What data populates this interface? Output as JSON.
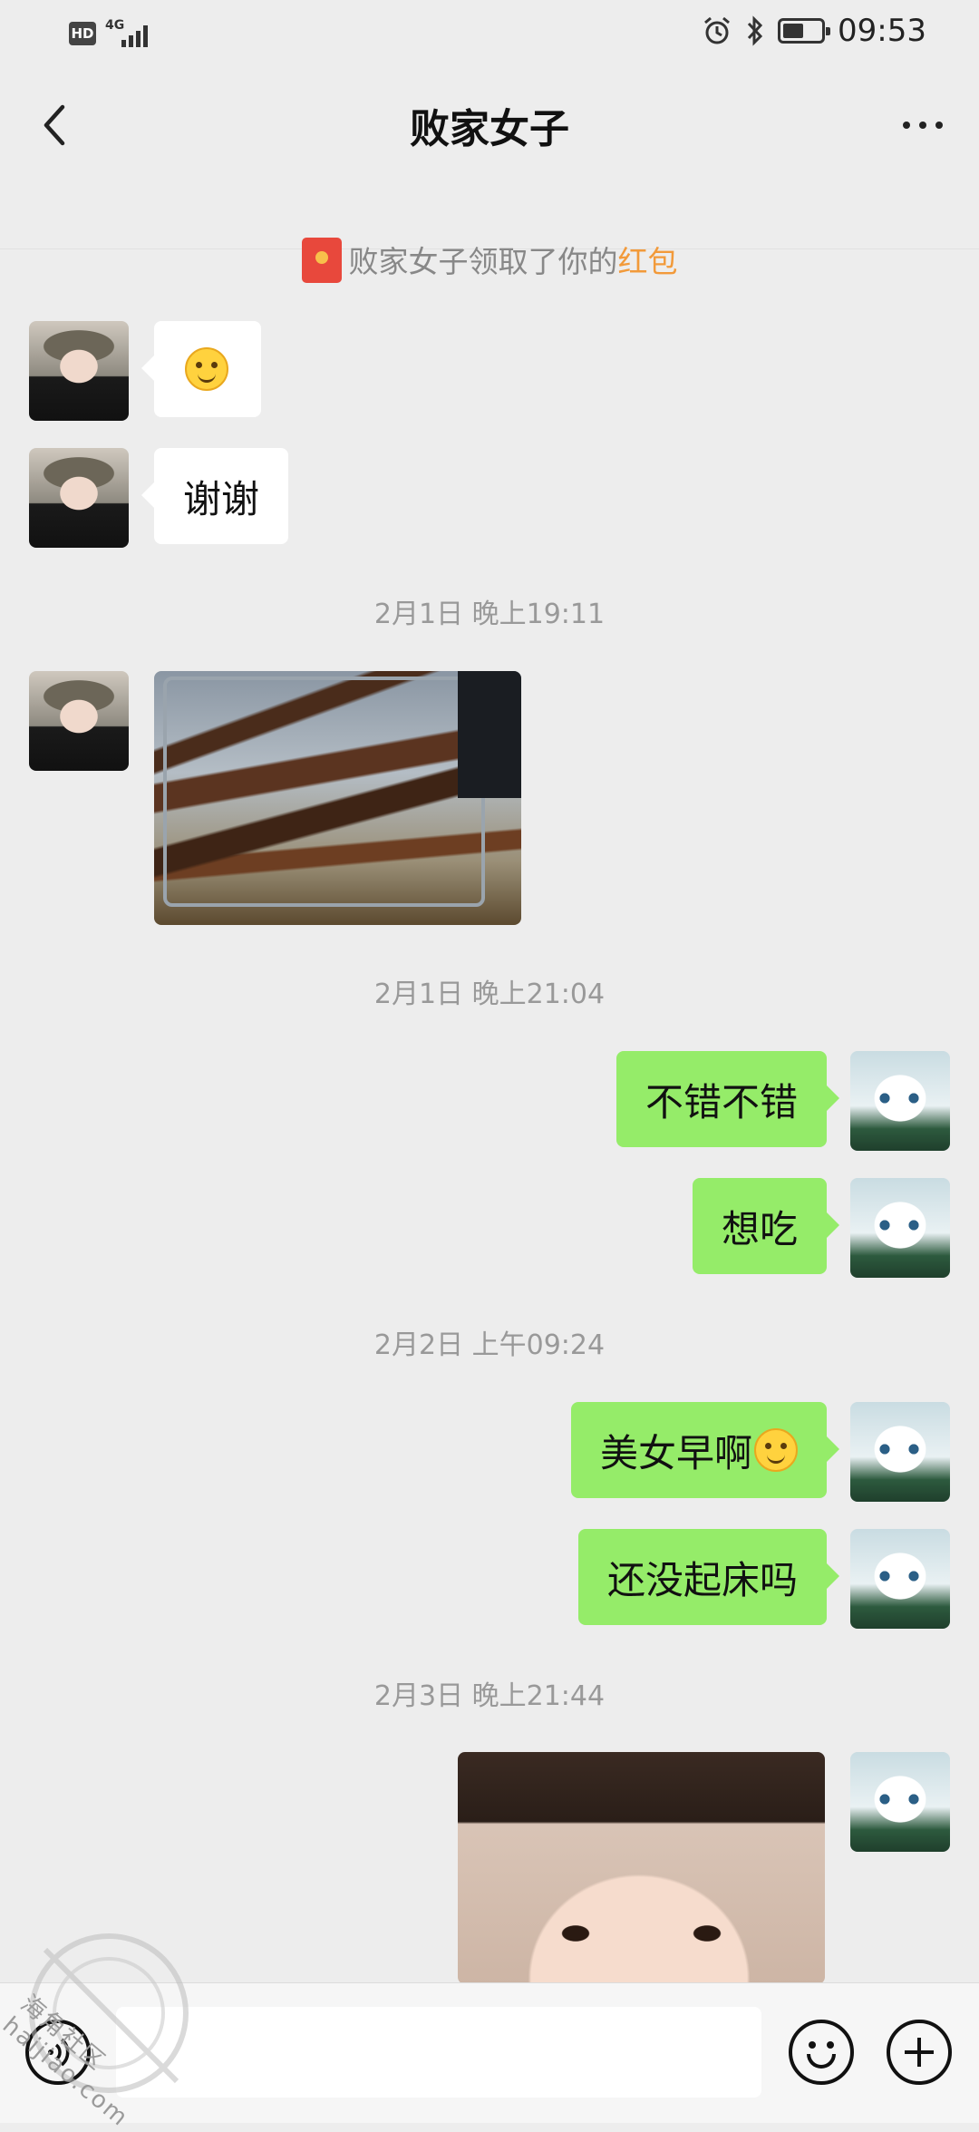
{
  "status_bar": {
    "hd_badge": "HD",
    "network": "4G",
    "time": "09:53",
    "battery_level": 0.55,
    "icons": [
      "alarm-icon",
      "bluetooth-icon",
      "battery-icon"
    ]
  },
  "header": {
    "title": "败家女子",
    "back_icon": "chevron-left-icon",
    "more_icon": "more-dots-icon"
  },
  "notice": {
    "prefix": "败家女子领取了你的",
    "highlight": "红包",
    "highlight_color": "#f29a3a",
    "icon": "red-packet-icon"
  },
  "messages": [
    {
      "side": "in",
      "type": "emoji",
      "emoji": "smiling-face"
    },
    {
      "side": "in",
      "type": "text",
      "text": "谢谢"
    },
    {
      "type": "timestamp",
      "text": "2月1日 晚上19:11"
    },
    {
      "side": "in",
      "type": "image",
      "image": "grilled-meat-photo"
    },
    {
      "type": "timestamp",
      "text": "2月1日 晚上21:04"
    },
    {
      "side": "out",
      "type": "text",
      "text": "不错不错"
    },
    {
      "side": "out",
      "type": "text",
      "text": "想吃"
    },
    {
      "type": "timestamp",
      "text": "2月2日 上午09:24"
    },
    {
      "side": "out",
      "type": "text",
      "text": "美女早啊",
      "trailing_emoji": "smiling-face"
    },
    {
      "side": "out",
      "type": "text",
      "text": "还没起床吗"
    },
    {
      "type": "timestamp",
      "text": "2月3日 晚上21:44"
    },
    {
      "side": "out",
      "type": "image",
      "image": "little-girl-photo"
    }
  ],
  "input_bar": {
    "voice_icon": "voice-icon",
    "emoji_icon": "emoji-icon",
    "plus_icon": "plus-icon",
    "value": ""
  },
  "colors": {
    "background": "#ededed",
    "outgoing_bubble": "#95ec69",
    "incoming_bubble": "#ffffff"
  },
  "watermark": {
    "line1": "海角社区",
    "line2": "haijiao.com"
  }
}
